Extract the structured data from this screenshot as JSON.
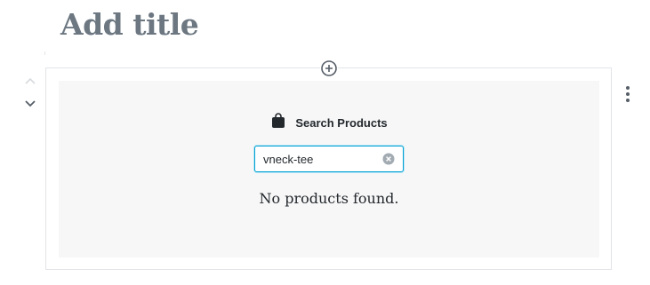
{
  "editor": {
    "title_placeholder": "Add title"
  },
  "block": {
    "label": "Search Products",
    "search": {
      "value": "vneck-tee",
      "placeholder": ""
    },
    "empty_message": "No products found."
  },
  "icons": {
    "inserter": "plus-circle-icon",
    "block": "shopping-bag-icon",
    "clear": "clear-circle-icon",
    "move_up": "chevron-up-icon",
    "move_down": "chevron-down-icon",
    "more": "more-vertical-icon"
  },
  "colors": {
    "focus_border": "#00a0d2",
    "placeholder_bg": "#f7f7f7",
    "title_text": "#6c7781"
  }
}
